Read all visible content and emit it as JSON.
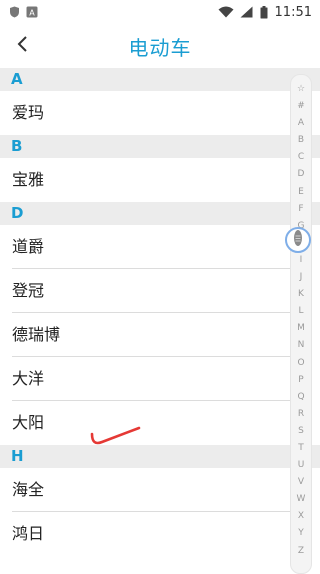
{
  "status_bar": {
    "time": "11:51",
    "icons": [
      "shield-icon",
      "a-icon",
      "wifi-icon",
      "cellular-icon",
      "battery-icon"
    ]
  },
  "app_bar": {
    "title": "电动车",
    "back_icon": "chevron-left-icon"
  },
  "sections": [
    {
      "letter": "A",
      "items": [
        "爱玛"
      ]
    },
    {
      "letter": "B",
      "items": [
        "宝雅"
      ]
    },
    {
      "letter": "D",
      "items": [
        "道爵",
        "登冠",
        "德瑞博",
        "大洋",
        "大阳"
      ]
    },
    {
      "letter": "H",
      "items": [
        "海全",
        "鸿日"
      ]
    }
  ],
  "alphabet_index": [
    "☆",
    "#",
    "A",
    "B",
    "C",
    "D",
    "E",
    "F",
    "G",
    "H",
    "I",
    "J",
    "K",
    "L",
    "M",
    "N",
    "O",
    "P",
    "Q",
    "R",
    "S",
    "T",
    "U",
    "V",
    "W",
    "X",
    "Y",
    "Z"
  ],
  "colors": {
    "accent": "#1a9dd2",
    "section_bg": "#ececec",
    "annotation": "#e53935"
  }
}
